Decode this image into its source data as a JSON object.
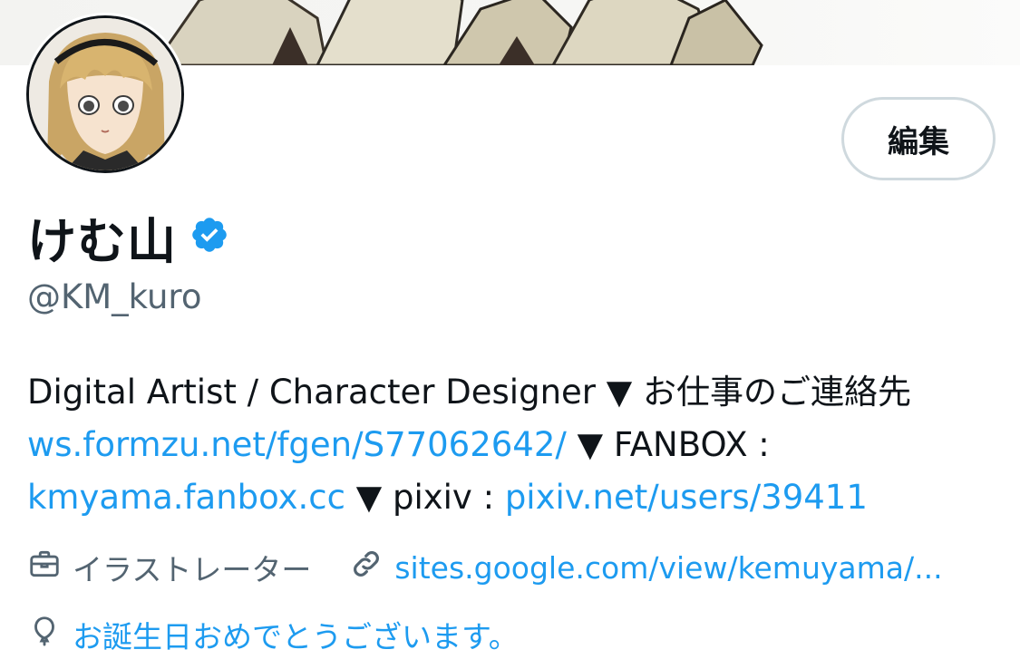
{
  "profile": {
    "display_name": "けむ山",
    "handle": "@KM_kuro",
    "verified": true,
    "edit_label": "編集"
  },
  "bio": {
    "line1_text": "Digital Artist / Character Designer ▼ お仕事のご連絡先",
    "line2_link": "ws.formzu.net/fgen/S77062642/",
    "line2_text": " ▼ FANBOX :",
    "line3_link1": "kmyama.fanbox.cc",
    "line3_text": " ▼ pixiv : ",
    "line3_link2": "pixiv.net/users/39411"
  },
  "meta": {
    "category_icon": "briefcase-icon",
    "category": "イラストレーター",
    "website_icon": "link-icon",
    "website": "sites.google.com/view/kemuyama/...",
    "birthday_icon": "balloon-icon",
    "birthday": "お誕生日おめでとうございます。"
  },
  "colors": {
    "link": "#1d9bf0",
    "secondary_text": "#536471",
    "primary_text": "#0f1419",
    "verified_badge": "#1d9bf0",
    "button_border": "#cfd9de"
  }
}
